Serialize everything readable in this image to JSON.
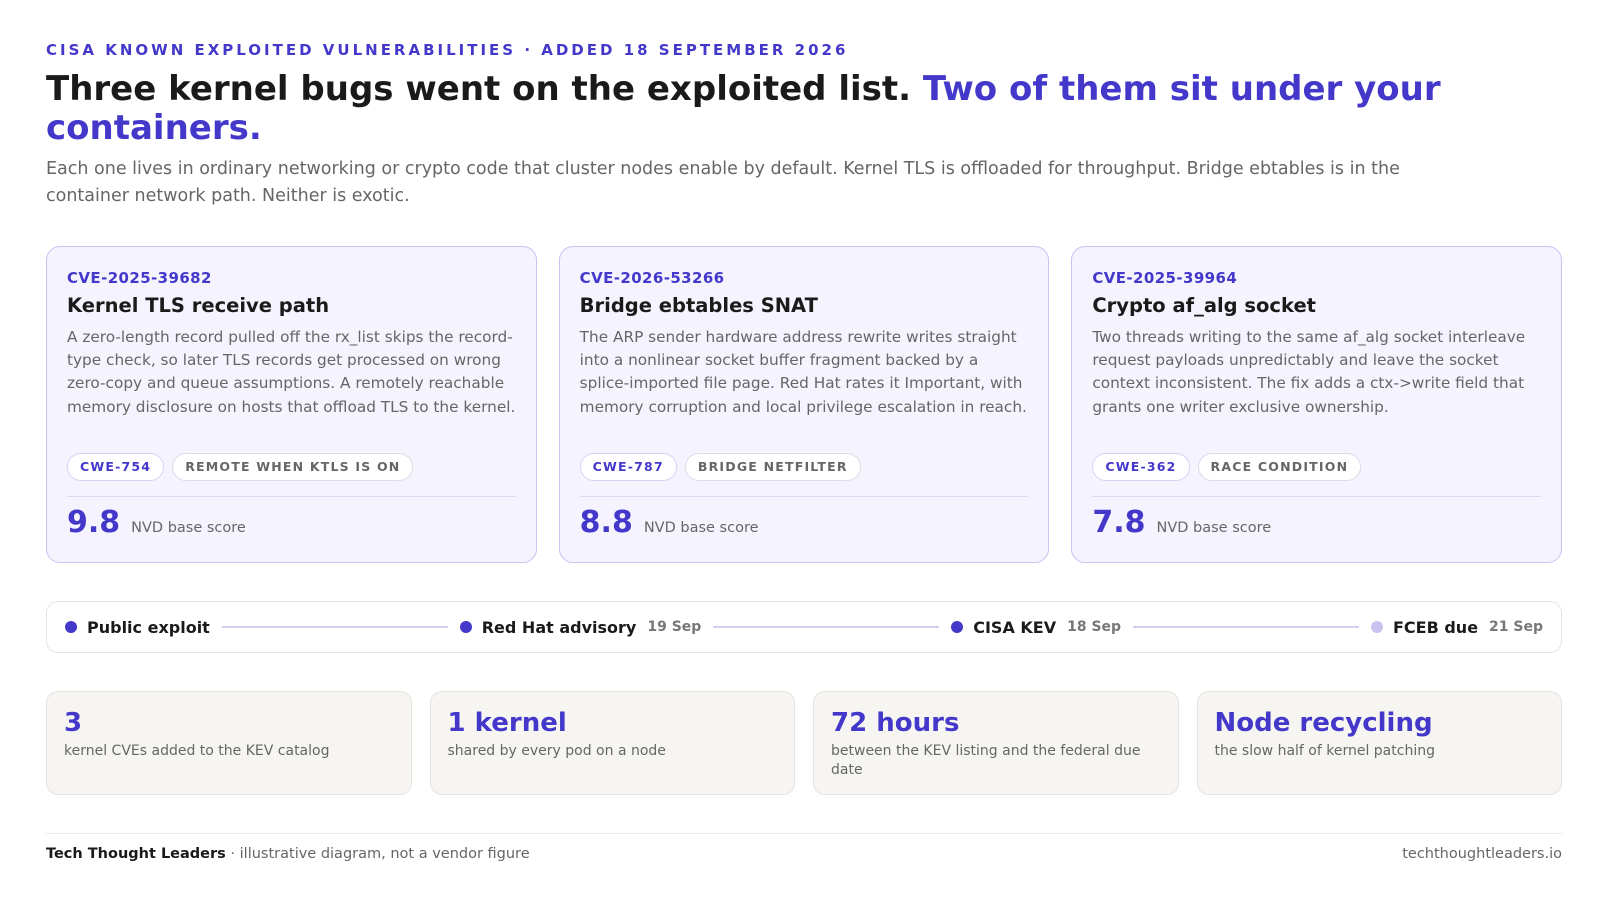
{
  "header": {
    "eyebrow": "CISA KNOWN EXPLOITED VULNERABILITIES · ADDED 18 SEPTEMBER 2026",
    "headline_main": "Three kernel bugs went on the exploited list.",
    "headline_accent": "Two of them sit under your containers.",
    "lede": "Each one lives in ordinary networking or crypto code that cluster nodes enable by default. Kernel TLS is offloaded for throughput. Bridge ebtables is in the container network path. Neither is exotic."
  },
  "cards": [
    {
      "id": "CVE-2025-39682",
      "title": "Kernel TLS receive path",
      "body": "A zero-length record pulled off the rx_list skips the record-type check, so later TLS records get processed on wrong zero-copy and queue assumptions. A remotely reachable memory disclosure on hosts that offload TLS to the kernel.",
      "cwe": "CWE-754",
      "tag": "REMOTE WHEN KTLS IS ON",
      "score": "9.8",
      "score_label": "NVD base score"
    },
    {
      "id": "CVE-2026-53266",
      "title": "Bridge ebtables SNAT",
      "body": "The ARP sender hardware address rewrite writes straight into a nonlinear socket buffer fragment backed by a splice-imported file page. Red Hat rates it Important, with memory corruption and local privilege escalation in reach.",
      "cwe": "CWE-787",
      "tag": "BRIDGE NETFILTER",
      "score": "8.8",
      "score_label": "NVD base score"
    },
    {
      "id": "CVE-2025-39964",
      "title": "Crypto af_alg socket",
      "body": "Two threads writing to the same af_alg socket interleave request payloads unpredictably and leave the socket context inconsistent. The fix adds a ctx->write field that grants one writer exclusive ownership.",
      "cwe": "CWE-362",
      "tag": "RACE CONDITION",
      "score": "7.8",
      "score_label": "NVD base score"
    }
  ],
  "timeline": [
    {
      "label": "Public exploit",
      "date": ""
    },
    {
      "label": "Red Hat advisory",
      "date": "19 Sep"
    },
    {
      "label": "CISA KEV",
      "date": "18 Sep"
    },
    {
      "label": "FCEB due",
      "date": "21 Sep"
    }
  ],
  "stats": [
    {
      "value": "3",
      "label": "kernel CVEs added to the KEV catalog"
    },
    {
      "value": "1 kernel",
      "label": "shared by every pod on a node"
    },
    {
      "value": "72 hours",
      "label": "between the KEV listing and the federal due date"
    },
    {
      "value": "Node recycling",
      "label": "the slow half of kernel patching"
    }
  ],
  "footer": {
    "brand": "Tech Thought Leaders",
    "note": " · illustrative diagram, not a vendor figure",
    "url": "techthoughtleaders.io"
  },
  "colors": {
    "accent": "#4338ca",
    "card_bg": "#f4f3fe",
    "stat_bg": "#f6f5f2",
    "muted_dot": "#c7c2f0"
  }
}
